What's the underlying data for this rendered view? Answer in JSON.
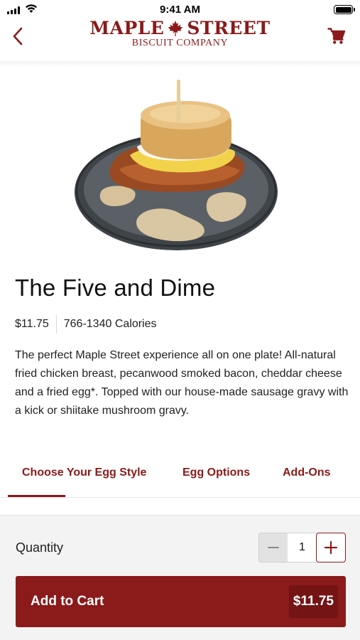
{
  "status_bar": {
    "time": "9:41 AM"
  },
  "header": {
    "logo_line1_left": "MAPLE",
    "logo_line1_right": "STREET",
    "logo_line2": "BISCUIT COMPANY",
    "icons": {
      "back": "chevron-left-icon",
      "cart": "shopping-cart-icon",
      "logo_mark": "maple-leaf-icon"
    }
  },
  "product": {
    "title": "The Five and Dime",
    "price": "$11.75",
    "calories": "766-1340 Calories",
    "description": "The perfect Maple Street experience all on one plate! All-natural fried chicken breast, pecanwood smoked bacon, cheddar cheese and a fried egg*. Topped with our house-made sausage gravy with a kick or shiitake mushroom gravy."
  },
  "tabs": [
    {
      "label": "Choose Your Egg Style",
      "active": true
    },
    {
      "label": "Egg Options",
      "active": false
    },
    {
      "label": "Add-Ons",
      "active": false
    }
  ],
  "order": {
    "quantity_label": "Quantity",
    "quantity": "1",
    "add_to_cart_label": "Add to Cart",
    "add_to_cart_price": "$11.75"
  },
  "colors": {
    "brand": "#8b1a1a",
    "brand_dark": "#741414",
    "panel_bg": "#f3f3f3"
  }
}
